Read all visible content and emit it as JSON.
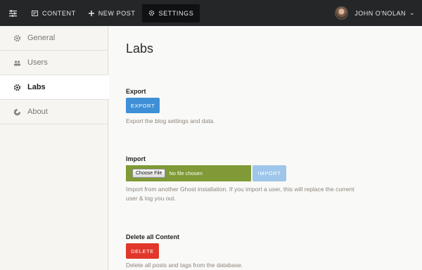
{
  "topbar": {
    "menu_icon": "sliders-icon",
    "items": [
      {
        "label": "CONTENT",
        "icon": "content-icon"
      },
      {
        "label": "NEW POST",
        "icon": "plus-icon"
      },
      {
        "label": "SETTINGS",
        "icon": "gear-icon"
      }
    ],
    "user_name": "JOHN O'NOLAN"
  },
  "sidebar": {
    "items": [
      {
        "label": "General",
        "icon": "gear-icon"
      },
      {
        "label": "Users",
        "icon": "users-icon"
      },
      {
        "label": "Labs",
        "icon": "labs-icon"
      },
      {
        "label": "About",
        "icon": "ghost-icon"
      }
    ]
  },
  "main": {
    "title": "Labs",
    "export": {
      "label": "Export",
      "button": "EXPORT",
      "help": "Export the blog settings and data."
    },
    "import": {
      "label": "Import",
      "choose_file": "Choose File",
      "no_file": "No file chosen",
      "button": "IMPORT",
      "help": "Import from another Ghost installation. If you import a user, this will replace the current user & log you out."
    },
    "delete": {
      "label": "Delete all Content",
      "button": "DELETE",
      "help": "Delete all posts and tags from the database."
    }
  },
  "colors": {
    "topbar": "#242628",
    "export": "#3e8fd6",
    "import_field": "#7f9a36",
    "import_button": "#9ec6ea",
    "delete": "#e0372a"
  }
}
